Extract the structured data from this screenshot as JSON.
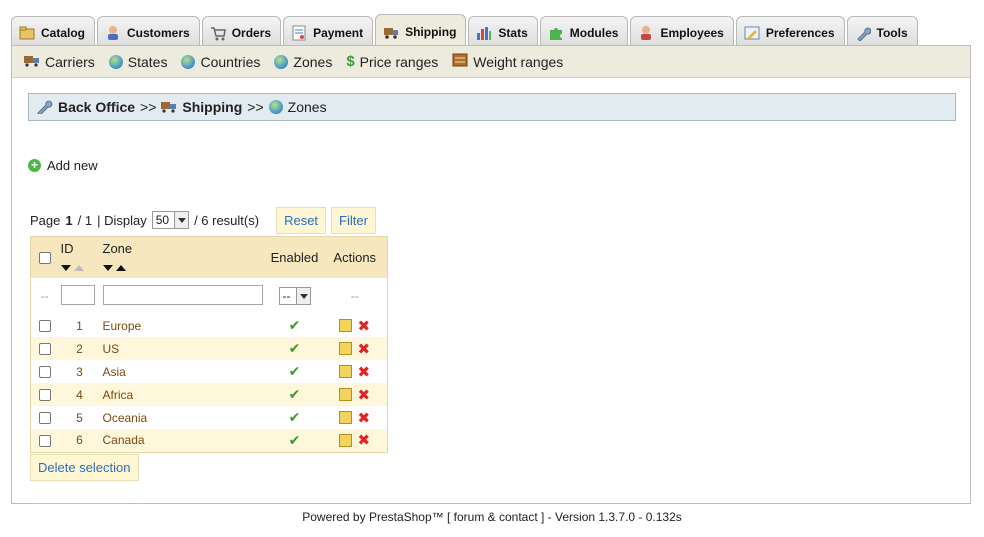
{
  "tabs": [
    {
      "label": "Catalog",
      "icon": "folder-icon"
    },
    {
      "label": "Customers",
      "icon": "customer-icon"
    },
    {
      "label": "Orders",
      "icon": "cart-icon"
    },
    {
      "label": "Payment",
      "icon": "payment-icon"
    },
    {
      "label": "Shipping",
      "icon": "truck-icon",
      "active": true
    },
    {
      "label": "Stats",
      "icon": "stats-icon"
    },
    {
      "label": "Modules",
      "icon": "puzzle-icon"
    },
    {
      "label": "Employees",
      "icon": "employee-icon"
    },
    {
      "label": "Preferences",
      "icon": "preferences-icon"
    },
    {
      "label": "Tools",
      "icon": "wrench-icon"
    }
  ],
  "subnav": [
    {
      "label": "Carriers",
      "icon": "truck-icon"
    },
    {
      "label": "States",
      "icon": "globe-icon"
    },
    {
      "label": "Countries",
      "icon": "globe-icon"
    },
    {
      "label": "Zones",
      "icon": "globe-icon"
    },
    {
      "label": "Price ranges",
      "icon": "dollar-icon"
    },
    {
      "label": "Weight ranges",
      "icon": "scale-icon"
    }
  ],
  "breadcrumb": {
    "root": "Back Office",
    "sep": ">>",
    "section": "Shipping",
    "current": "Zones"
  },
  "add_new": "Add new",
  "pager": {
    "page_label": "Page",
    "page": "1",
    "of": "/ 1",
    "display_label": "| Display",
    "display_value": "50",
    "results": "/ 6 result(s)"
  },
  "buttons": {
    "reset": "Reset",
    "filter": "Filter",
    "delete": "Delete selection"
  },
  "table": {
    "headers": {
      "id": "ID",
      "zone": "Zone",
      "enabled": "Enabled",
      "actions": "Actions"
    },
    "filter": {
      "id_dash": "--",
      "enabled_select": "--",
      "actions_dash": "--"
    },
    "rows": [
      {
        "id": "1",
        "zone": "Europe"
      },
      {
        "id": "2",
        "zone": "US"
      },
      {
        "id": "3",
        "zone": "Asia"
      },
      {
        "id": "4",
        "zone": "Africa"
      },
      {
        "id": "5",
        "zone": "Oceania"
      },
      {
        "id": "6",
        "zone": "Canada"
      }
    ]
  },
  "footer": "Powered by PrestaShop™ [ forum & contact ] - Version 1.3.7.0 - 0.132s"
}
